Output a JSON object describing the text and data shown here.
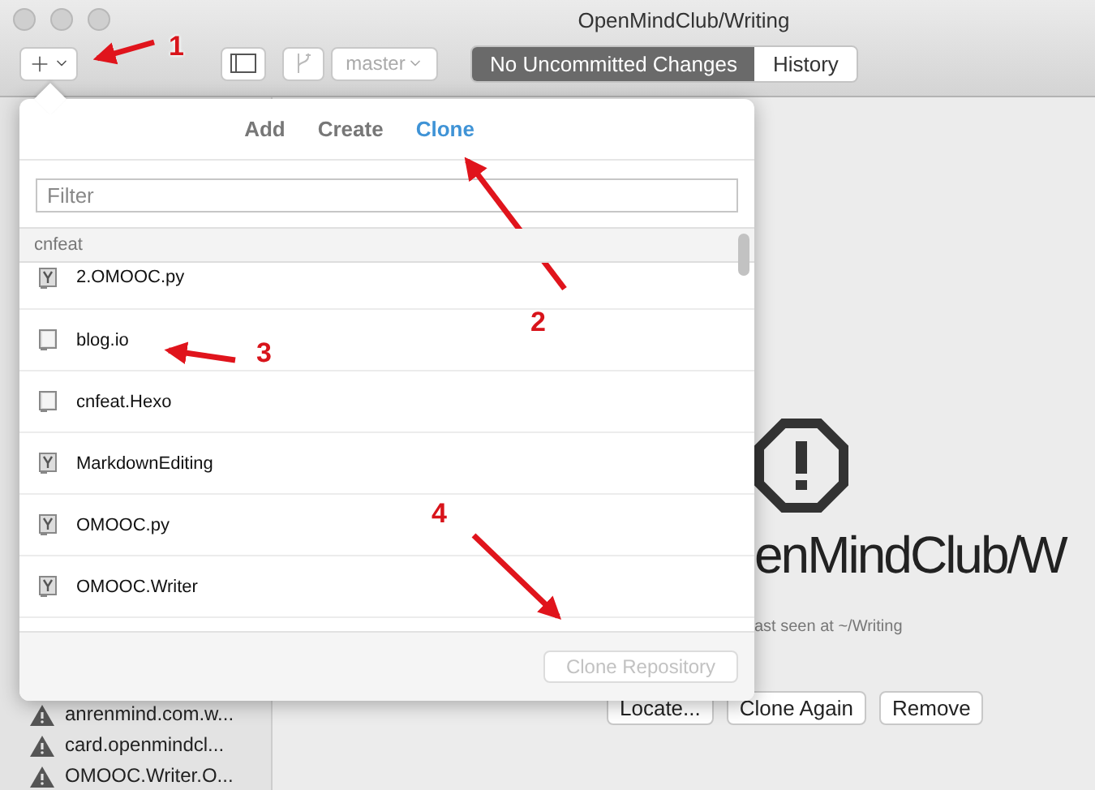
{
  "window": {
    "title": "OpenMindClub/Writing"
  },
  "toolbar": {
    "branch_menu": {
      "label": "master",
      "disabled": true
    },
    "segments": [
      {
        "label": "No Uncommitted Changes",
        "selected": true
      },
      {
        "label": "History",
        "selected": false
      }
    ]
  },
  "sidebar": {
    "items": [
      {
        "label": "anrenmind.com.w..."
      },
      {
        "label": "card.openmindcl..."
      },
      {
        "label": "OMOOC.Writer.O..."
      }
    ]
  },
  "main": {
    "title": "enMindClub/W",
    "subtitle": "ast seen at ~/Writing",
    "buttons": [
      "Locate...",
      "Clone Again",
      "Remove"
    ]
  },
  "popover": {
    "tabs": [
      {
        "label": "Add",
        "selected": false
      },
      {
        "label": "Create",
        "selected": false
      },
      {
        "label": "Clone",
        "selected": true
      }
    ],
    "filter": {
      "placeholder": "Filter"
    },
    "group": "cnfeat",
    "repositories": [
      {
        "name": "2.OMOOC.py",
        "kind": "marked"
      },
      {
        "name": "blog.io",
        "kind": "plain"
      },
      {
        "name": "cnfeat.Hexo",
        "kind": "plain"
      },
      {
        "name": "MarkdownEditing",
        "kind": "marked"
      },
      {
        "name": "OMOOC.py",
        "kind": "marked"
      },
      {
        "name": "OMOOC.Writer",
        "kind": "marked"
      }
    ],
    "clone_button": {
      "label": "Clone Repository",
      "disabled": true
    }
  },
  "annotations": [
    {
      "label": "1"
    },
    {
      "label": "2"
    },
    {
      "label": "3"
    },
    {
      "label": "4"
    }
  ]
}
